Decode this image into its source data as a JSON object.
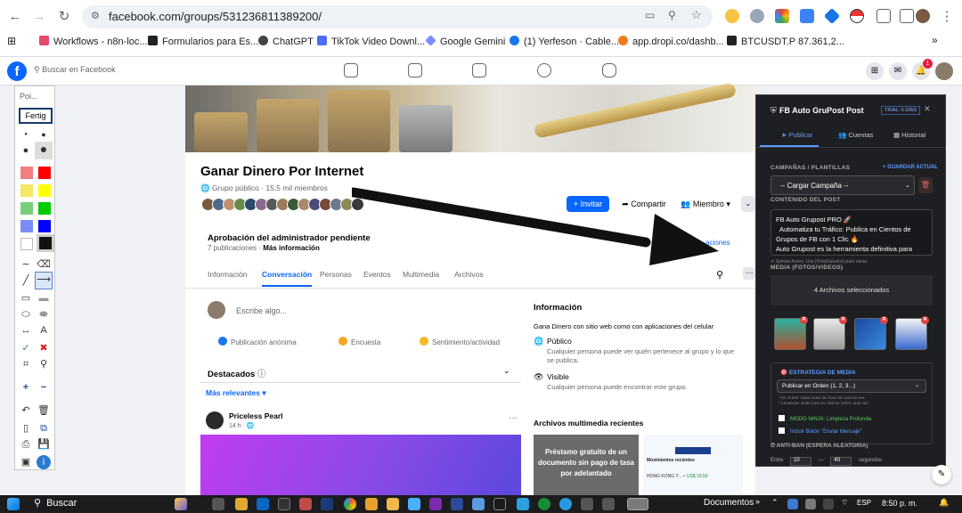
{
  "browser": {
    "url": "facebook.com/groups/531236811389200/",
    "bookmarks": [
      {
        "label": "Workflows - n8n-loc...",
        "color": "#e34c6b"
      },
      {
        "label": "Formularios para Es...",
        "color": "#222222"
      },
      {
        "label": "ChatGPT",
        "color": "#444444"
      },
      {
        "label": "TikTok Video Downl...",
        "color": "#4c6ef5"
      },
      {
        "label": "Google Gemini",
        "color": "#7b8cff"
      },
      {
        "label": "(1) Yerfeson · Cable...",
        "color": "#1877f2"
      },
      {
        "label": "app.dropi.co/dashb...",
        "color": "#f07b1c"
      },
      {
        "label": "BTCUSDT.P 87.361,2...",
        "color": "#222222"
      }
    ]
  },
  "fb": {
    "search_placeholder": "Buscar en Facebook",
    "notif_count": "1"
  },
  "group": {
    "name": "Ganar Dinero Por Internet",
    "meta": "Grupo público · 15,5 mil miembros",
    "invite": "+ Invitar",
    "share": "Compartir",
    "member": "Miembro",
    "pending_title": "Aprobación del administrador pendiente",
    "pending_sub": "7 publicaciones",
    "pending_more": "Más información",
    "pending_link": "aciones",
    "tabs": [
      "Información",
      "Conversación",
      "Personas",
      "Eventos",
      "Multimedia",
      "Archivos"
    ],
    "composer_placeholder": "Escribe algo...",
    "composer_actions": [
      "Publicación anónima",
      "Encuesta",
      "Sentimiento/actividad"
    ],
    "destacados": "Destacados",
    "relevantes": "Más relevantes",
    "post_author": "Priceless Pearl",
    "post_time": "14 h ·"
  },
  "info": {
    "title": "Información",
    "desc": "Gana Dinero con sitio web como con aplicaciones del celular",
    "public_title": "Público",
    "public_desc": "Cualquier persona puede ver quién pertenece al grupo y lo que se publica.",
    "visible_title": "Visible",
    "visible_desc": "Cualquier persona puede encontrar este grupo.",
    "media_title": "Archivos multimedia recientes",
    "media_img1": "Préstamo gratuito de un documento sin pago de tasa por adelantado",
    "media_img2_title": "Movimientos recientes",
    "media_img2_row": "HONG KONG Y...",
    "media_img2_amount": "+ US$ 16,50"
  },
  "toolbar": {
    "poi": "Poi...",
    "fertig": "Fertig",
    "colors": [
      "#f08080",
      "#ff0000",
      "#f5e663",
      "#ffff00",
      "#7ad07a",
      "#00cc00",
      "#7a8cf5",
      "#0000ff",
      "#ffffff",
      "#111111"
    ]
  },
  "ext": {
    "title": "FB Auto GruPost Post",
    "trial": "TRIAL: 5 DÍAS",
    "tabs": [
      "Publicar",
      "Cuentas",
      "Historial"
    ],
    "campaigns_label": "CAMPAÑAS / PLANTILLAS",
    "save_label": "+ GUARDAR ACTUAL",
    "load_campaign": "-- Cargar Campaña --",
    "content_label": "CONTENIDO DEL POST",
    "content_lines": [
      "FB Auto Grupost PRO 🚀",
      "Automatiza tu Tráfico: Publica en Cientos de",
      "Grupos de FB con 1 Clic 🔥",
      "Auto Grupost es la herramienta definitiva para"
    ],
    "spintax": "✦ Spintax Activo: Usa {Hola|Saludos} para variar.",
    "media_label": "MEDIA (FOTOS/VIDEOS)",
    "files_selected": "4 Archivos seleccionados",
    "strategy_label": "ESTRATEGIA DE MEDIA",
    "order_option": "Publicar en Orden (1, 2, 3...)",
    "order_note1": "* En Orden: Sube todas las fotos tal cual las ves.",
    "order_note2": "* Aleatorias: Sube fotos en distinto orden cada vez.",
    "ninja": "MODO NINJA: Limpieza Profunda",
    "inbox": "Incluir Botón \"Enviar Mensaje\"",
    "antiban": "ANTI-BAN (ESPERA ALEATORIA)",
    "range_label": "Entre",
    "range_min": "10",
    "range_max": "40",
    "range_unit": "segundos"
  },
  "taskbar": {
    "search": "Buscar",
    "docs": "Documentos",
    "lang": "ESP",
    "time": "8:50 p. m."
  }
}
